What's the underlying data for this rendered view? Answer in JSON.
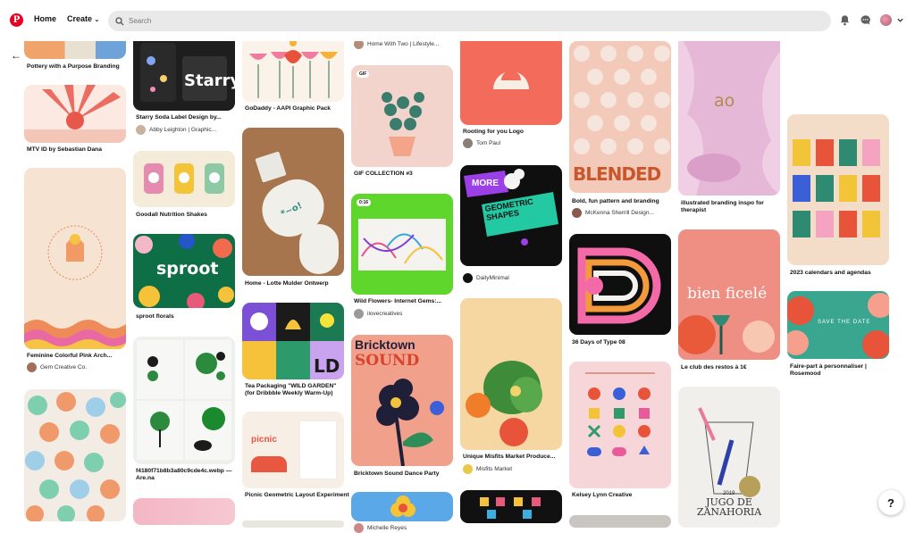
{
  "nav": {
    "logo_letter": "P",
    "home": "Home",
    "create": "Create"
  },
  "search": {
    "placeholder": "Search"
  },
  "help_label": "?",
  "pins": {
    "c1p1": {
      "caption": "Pottery with a Purpose Branding"
    },
    "c1p2": {
      "caption": "MTV ID by Sebastian Dana"
    },
    "c1p3": {
      "caption": "Feminine Colorful Pink Arch...",
      "user": "Gem Creative Co."
    },
    "c2p1": {
      "caption": "Starry Soda Label Design by...",
      "user": "Abby Leighton | Graphic..."
    },
    "c2p2": {
      "caption": "Goodall Nutrition Shakes"
    },
    "c2p3": {
      "caption": "sproot florals",
      "image_text": "sproot"
    },
    "c2p4": {
      "caption": "f4180f71b8b3a80c9cde4c.webp — Are.na"
    },
    "c3p1": {
      "caption": "GoDaddy - AAPI Graphic Pack"
    },
    "c3p2": {
      "caption": "Home - Lotte Mulder Ontwerp"
    },
    "c3p3": {
      "caption": "Tea Packaging \"WILD GARDEN\" (for Dribbble Weekly Warm-Up)"
    },
    "c3p4": {
      "caption": "Picnic Geometric Layout Experiment",
      "image_text": "picnic"
    },
    "c4p0": {
      "user": "Home With Two | Lifestyle..."
    },
    "c4p1": {
      "caption": "GIF COLLECTION #3",
      "badge": "GIF"
    },
    "c4p2": {
      "caption": "Wild Flowers- Internet Gems:...",
      "user": "ilovecreatives",
      "badge": "0:16"
    },
    "c4p3": {
      "caption": "Bricktown Sound Dance Party",
      "image_text_1": "Bricktown",
      "image_text_2": "SOUND"
    },
    "c4p4": {
      "user": "Michelle Reyes"
    },
    "c5p1": {
      "caption": "Rooting for you Logo",
      "user": "Tom Paul"
    },
    "c5p2": {
      "user": "DailyMinimal",
      "image_text_1": "MORE",
      "image_text_2": "GEOMETRIC SHAPES"
    },
    "c5p3": {
      "caption": "Unique Misfits Market Produce...",
      "user": "Misfits Market"
    },
    "c6p1": {
      "caption": "Bold, fun pattern and branding",
      "user": "McKenna Sherrill Design...",
      "image_text": "BLENDED"
    },
    "c6p2": {
      "caption": "36 Days of Type 08"
    },
    "c6p3": {
      "caption": "Kelsey Lynn Creative"
    },
    "c7p1": {
      "caption": "illustrated branding inspo for therapist",
      "image_text": "ao"
    },
    "c7p2": {
      "caption": "Le club des restos à 1€",
      "image_text": "bien ficelé"
    },
    "c7p3": {
      "image_text_1": "2019",
      "image_text_2": "JUGO DE ZANAHORIA"
    },
    "c8p1": {
      "caption": "2023 calendars and agendas"
    },
    "c8p2": {
      "caption": "Faire-part à personnaliser | Rosemood",
      "image_text": "SAVE THE DATE"
    }
  }
}
